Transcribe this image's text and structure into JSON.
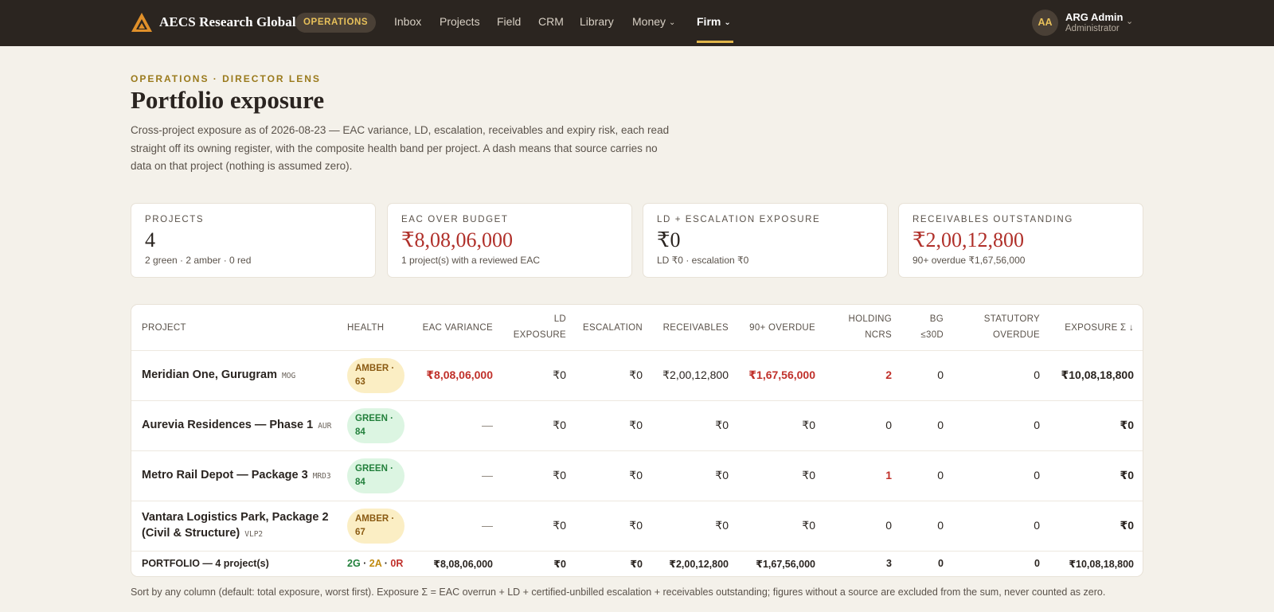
{
  "nav": {
    "brand": "AECS Research Global",
    "badge": "OPERATIONS",
    "items": [
      {
        "label": "Inbox"
      },
      {
        "label": "Projects"
      },
      {
        "label": "Field"
      },
      {
        "label": "CRM"
      },
      {
        "label": "Library"
      },
      {
        "label": "Money",
        "chev": "⌄"
      },
      {
        "label": "Firm",
        "chev": "⌄"
      }
    ],
    "user": {
      "initials": "AA",
      "name": "ARG Admin",
      "role": "Administrator",
      "chev": "⌄"
    }
  },
  "header": {
    "eyebrow": "OPERATIONS · DIRECTOR LENS",
    "title": "Portfolio exposure",
    "description": "Cross-project exposure as of 2026-08-23 — EAC variance, LD, escalation, receivables and expiry risk, each read straight off its owning register, with the composite health band per project. A dash means that source carries no data on that project (nothing is assumed zero)."
  },
  "kpis": [
    {
      "label": "PROJECTS",
      "value": "4",
      "sub": "2 green · 2 amber · 0 red"
    },
    {
      "label": "EAC OVER BUDGET",
      "value": "₹8,08,06,000",
      "sub": "1 project(s) with a reviewed EAC"
    },
    {
      "label": "LD + ESCALATION EXPOSURE",
      "value": "₹0",
      "sub": "LD ₹0 · escalation ₹0"
    },
    {
      "label": "RECEIVABLES OUTSTANDING",
      "value": "₹2,00,12,800",
      "sub": "90+ overdue ₹1,67,56,000"
    }
  ],
  "table": {
    "headers": {
      "project": "PROJECT",
      "health": "HEALTH",
      "eac": "EAC VARIANCE",
      "ld_1": "LD",
      "ld_2": "EXPOSURE",
      "escalation": "ESCALATION",
      "receivables": "RECEIVABLES",
      "overdue": "90+ OVERDUE",
      "ncr_1": "HOLDING",
      "ncr_2": "NCRS",
      "bg_1": "BG",
      "bg_2": "≤30D",
      "stat_1": "STATUTORY",
      "stat_2": "OVERDUE",
      "exposure": "EXPOSURE Σ ↓"
    },
    "rows": [
      {
        "name": "Meridian One, Gurugram",
        "code": "MOG",
        "health_1": "AMBER ·",
        "health_2": "63",
        "eac": "₹8,08,06,000",
        "ld": "₹0",
        "escalation": "₹0",
        "receivables": "₹2,00,12,800",
        "overdue": "₹1,67,56,000",
        "ncrs": "2",
        "bg": "0",
        "statutory": "0",
        "exposure": "₹10,08,18,800"
      },
      {
        "name": "Aurevia Residences — Phase 1",
        "code": "AUR",
        "health_1": "GREEN ·",
        "health_2": "84",
        "eac": "—",
        "ld": "₹0",
        "escalation": "₹0",
        "receivables": "₹0",
        "overdue": "₹0",
        "ncrs": "0",
        "bg": "0",
        "statutory": "0",
        "exposure": "₹0"
      },
      {
        "name": "Metro Rail Depot — Package 3",
        "code": "MRD3",
        "health_1": "GREEN ·",
        "health_2": "84",
        "eac": "—",
        "ld": "₹0",
        "escalation": "₹0",
        "receivables": "₹0",
        "overdue": "₹0",
        "ncrs": "1",
        "bg": "0",
        "statutory": "0",
        "exposure": "₹0"
      },
      {
        "name_1": "Vantara Logistics Park, Package 2",
        "name_2": "(Civil & Structure)",
        "code": "VLP2",
        "health_1": "AMBER ·",
        "health_2": "67",
        "eac": "—",
        "ld": "₹0",
        "escalation": "₹0",
        "receivables": "₹0",
        "overdue": "₹0",
        "ncrs": "0",
        "bg": "0",
        "statutory": "0",
        "exposure": "₹0"
      }
    ],
    "footer": {
      "label": "PORTFOLIO — 4 project(s)",
      "mix_g": "2G",
      "mix_a": "2A",
      "mix_r": "0R",
      "mix_sep": " · ",
      "eac": "₹8,08,06,000",
      "ld": "₹0",
      "escalation": "₹0",
      "receivables": "₹2,00,12,800",
      "overdue": "₹1,67,56,000",
      "ncrs": "3",
      "bg": "0",
      "statutory": "0",
      "exposure": "₹10,08,18,800"
    }
  },
  "footnote": "Sort by any column (default: total exposure, worst first). Exposure Σ = EAC overrun + LD + certified-unbilled escalation + receivables outstanding; figures without a source are excluded from the sum, never counted as zero.",
  "colors": {
    "accent": "#e0b54a",
    "nav_bg": "#2b2520",
    "red": "#c0302a",
    "green": "#23803c",
    "amber": "#8a5a12"
  }
}
